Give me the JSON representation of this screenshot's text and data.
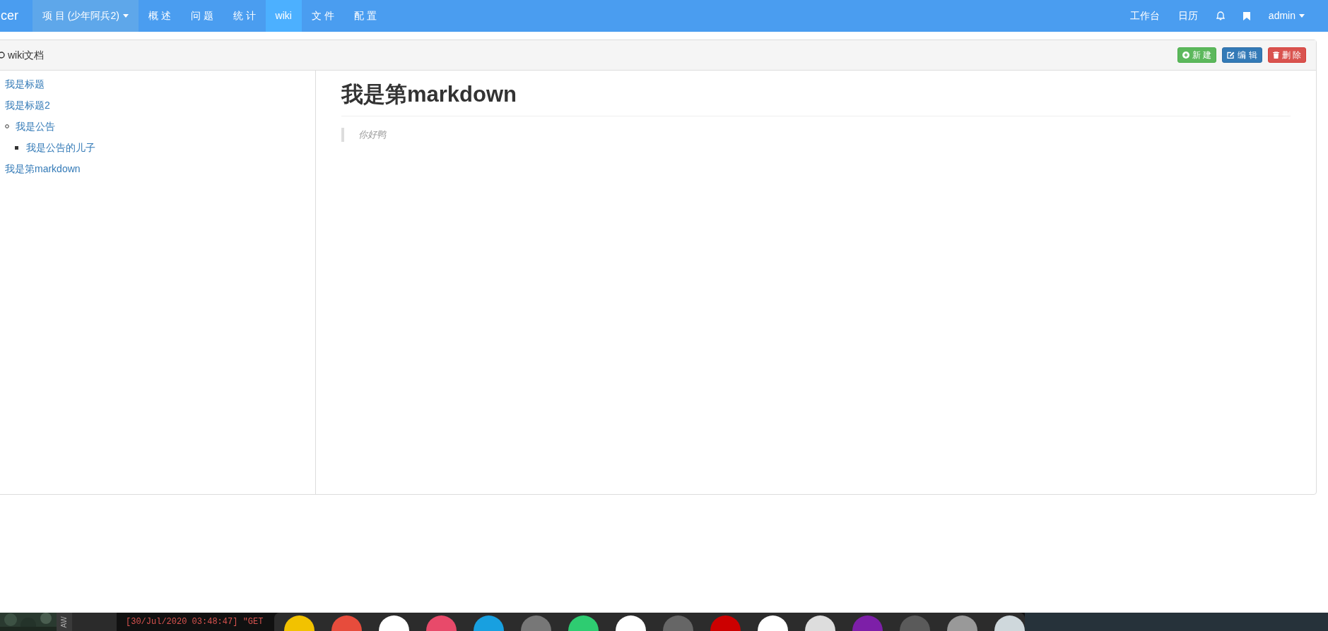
{
  "navbar": {
    "brand": "cer",
    "items": [
      {
        "label": "项 目 (少年阿兵2)",
        "dropdown": true,
        "selected": false
      },
      {
        "label": "概 述",
        "dropdown": false,
        "selected": false
      },
      {
        "label": "问 题",
        "dropdown": false,
        "selected": false
      },
      {
        "label": "统 计",
        "dropdown": false,
        "selected": false
      },
      {
        "label": "wiki",
        "dropdown": false,
        "selected": true
      },
      {
        "label": "文 件",
        "dropdown": false,
        "selected": false
      },
      {
        "label": "配 置",
        "dropdown": false,
        "selected": false
      }
    ],
    "right": [
      {
        "kind": "text",
        "label": "工作台"
      },
      {
        "kind": "text",
        "label": "日历"
      },
      {
        "kind": "bell"
      },
      {
        "kind": "bookmark"
      },
      {
        "kind": "user",
        "label": "admin"
      }
    ]
  },
  "panel": {
    "title": "wiki文档",
    "buttons": [
      {
        "kind": "new",
        "label": "新 建"
      },
      {
        "kind": "edit",
        "label": "编 辑"
      },
      {
        "kind": "delete",
        "label": "删 除"
      }
    ],
    "sidebar": {
      "items": [
        {
          "label": "我是标题"
        },
        {
          "label": "我是标题2",
          "children": [
            {
              "label": "我是公告",
              "children": [
                {
                  "label": "我是公告的儿子"
                }
              ]
            }
          ]
        },
        {
          "label": "我是第markdown"
        }
      ]
    },
    "content": {
      "heading": "我是第markdown",
      "blockquote": "你好鸭"
    }
  },
  "taskbar": {
    "side_label": "AW",
    "terminal_line": "[30/Jul/2020 03:48:47] \"GET"
  }
}
